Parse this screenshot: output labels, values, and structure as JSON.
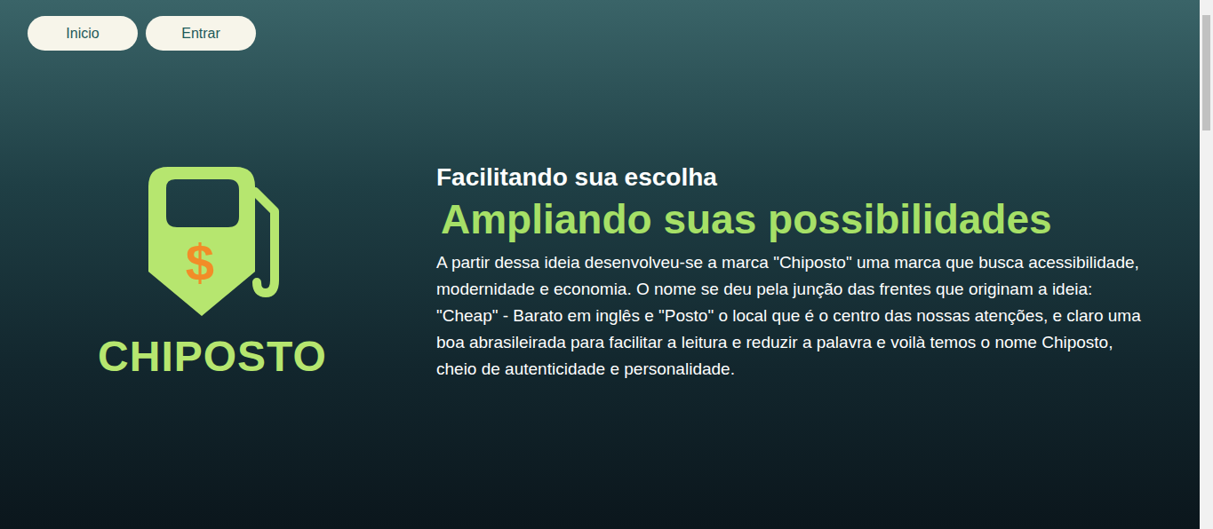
{
  "nav": {
    "buttons": [
      {
        "label": "Inicio"
      },
      {
        "label": "Entrar"
      }
    ]
  },
  "logo": {
    "symbol": "$",
    "name": "CHIPOSTO"
  },
  "hero": {
    "heading": "Facilitando sua escolha",
    "subheading": "Ampliando suas possibilidades",
    "paragraph": "A partir dessa ideia desenvolveu-se a marca \"Chiposto\" uma marca que busca acessibilidade, modernidade e economia. O nome se deu pela junção das frentes que originam a ideia: \"Cheap\" - Barato em inglês e \"Posto\" o local que é o centro das nossas atenções, e claro uma boa abrasileirada para facilitar a leitura e reduzir a palavra e voilà temos o nome Chiposto, cheio de autenticidade e personalidade."
  }
}
